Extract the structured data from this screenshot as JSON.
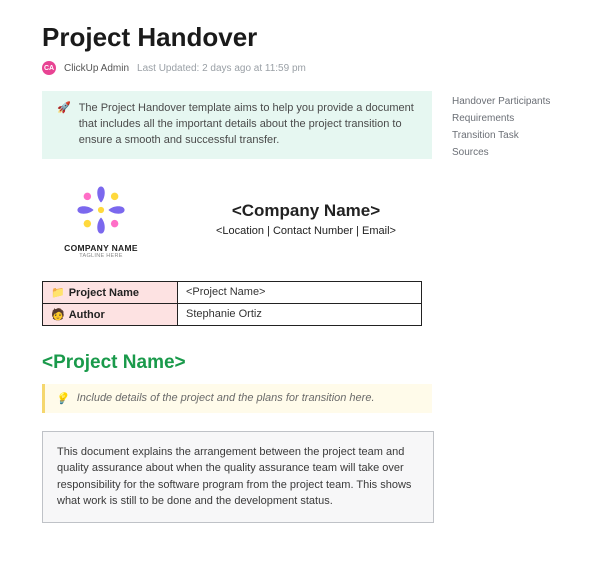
{
  "title": "Project Handover",
  "meta": {
    "avatar_initials": "CA",
    "author": "ClickUp Admin",
    "updated": "Last Updated: 2 days ago at 11:59 pm"
  },
  "toc": [
    {
      "label": "Handover Participants"
    },
    {
      "label": "Requirements"
    },
    {
      "label": "Transition Task"
    },
    {
      "label": "Sources"
    }
  ],
  "intro_callout": {
    "emoji": "🚀",
    "text": "The Project Handover template aims to help you provide a document that includes all the important details about the project transition to ensure a smooth and successful transfer."
  },
  "logo": {
    "name": "COMPANY NAME",
    "tagline": "TAGLINE HERE"
  },
  "hero": {
    "company": "<Company Name>",
    "sub": "<Location | Contact Number | Email>"
  },
  "info_table": {
    "rows": [
      {
        "emoji": "📁",
        "label": "Project Name",
        "value": "<Project Name>"
      },
      {
        "emoji": "🧑",
        "label": "Author",
        "value": "Stephanie Ortiz"
      }
    ]
  },
  "section_heading": "<Project Name>",
  "detail_callout": {
    "emoji": "💡",
    "text": "Include details of the project and the plans for transition here."
  },
  "description": "This document explains the arrangement between the project team and quality assurance about when the quality assurance team will take over responsibility for the software program from the project team. This shows what work is still to be done and the development status."
}
